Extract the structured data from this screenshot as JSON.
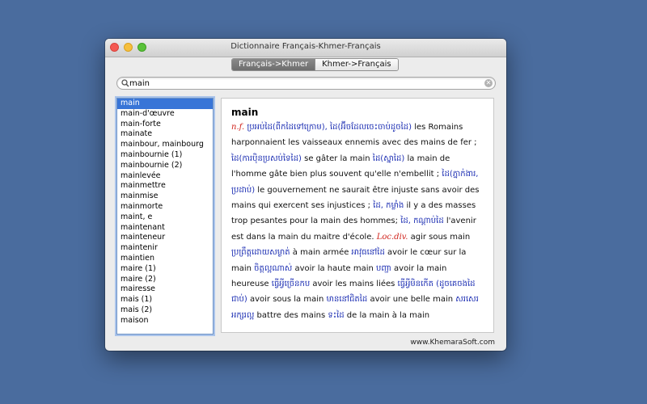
{
  "window": {
    "title": "Dictionnaire Français-Khmer-Français",
    "tabs": [
      {
        "label": "Français->Khmer",
        "active": true
      },
      {
        "label": "Khmer->Français",
        "active": false
      }
    ],
    "search": {
      "value": "main",
      "clear_icon": "clear-icon"
    },
    "footer": "www.KhemaraSoft.com"
  },
  "word_list": [
    "main",
    "main-d'œuvre",
    "main-forte",
    "mainate",
    "mainbour, mainbourg",
    "mainbournie (1)",
    "mainbournie (2)",
    "mainlevée",
    "mainmettre",
    "mainmise",
    "mainmorte",
    "maint, e",
    "maintenant",
    "mainteneur",
    "maintenir",
    "maintien",
    "maire (1)",
    "maire (2)",
    "mairesse",
    "mais (1)",
    "mais (2)",
    "maison"
  ],
  "entry": {
    "headword": "main",
    "segments": [
      {
        "t": "n.f.",
        "k": "abbr"
      },
      {
        "t": " ប្រអប់ដៃ(ពីកដៃទៅក្រោម), ដៃ(អ៊ីចដែលចេះចាប់ដូចដៃ)",
        "k": "km"
      },
      {
        "t": " les Romains harponnaient les vaisseaux ennemis avec des mains de fer ; ",
        "k": "fr"
      },
      {
        "t": "ដៃ(ការប៉ិនប្រសប់ទៃដៃ)",
        "k": "km"
      },
      {
        "t": " se gâter la main ",
        "k": "fr"
      },
      {
        "t": "ដៃ(ស្នាដៃ)",
        "k": "km"
      },
      {
        "t": " la main de l'homme gâte bien plus souvent qu'elle n'embellit ; ",
        "k": "fr"
      },
      {
        "t": "ដៃ(ភ្នាក់ងារ, ប្រដាប់)",
        "k": "km"
      },
      {
        "t": " le gouvernement ne saurait être injuste sans avoir des mains qui exercent ses injustices ; ",
        "k": "fr"
      },
      {
        "t": "ដៃ, កម្លាំង",
        "k": "km"
      },
      {
        "t": " il y a des masses trop pesantes pour la main des hommes; ",
        "k": "fr"
      },
      {
        "t": "ដៃ, កណ្ដាប់ដៃ",
        "k": "km"
      },
      {
        "t": " l'avenir est dans la main du maitre d'école. ",
        "k": "fr"
      },
      {
        "t": "Loc.div.",
        "k": "abbr"
      },
      {
        "t": " agir sous main ",
        "k": "fr"
      },
      {
        "t": "ប្រព្រឹត្តដោយសម្ងាត់",
        "k": "km"
      },
      {
        "t": " à main armée ",
        "k": "fr"
      },
      {
        "t": "អាវុធនៅដៃ",
        "k": "km"
      },
      {
        "t": " avoir le cœur sur la main ",
        "k": "fr"
      },
      {
        "t": "ចិត្តល្អណាស់",
        "k": "km"
      },
      {
        "t": " avoir la haute main ",
        "k": "fr"
      },
      {
        "t": "បញ្ជា",
        "k": "km"
      },
      {
        "t": " avoir la main heureuse ",
        "k": "fr"
      },
      {
        "t": "ធ្វើអ្វីច្រើនកប",
        "k": "km"
      },
      {
        "t": " avoir les mains liées ",
        "k": "fr"
      },
      {
        "t": "ធ្វើអ្វីមិនកើត (ដូចគេចងដៃជាប់)",
        "k": "km"
      },
      {
        "t": " avoir sous la main ",
        "k": "fr"
      },
      {
        "t": "មាននៅជិតដៃ",
        "k": "km"
      },
      {
        "t": " avoir une belle main ",
        "k": "fr"
      },
      {
        "t": "សរសេរអក្សរល្អ",
        "k": "km"
      },
      {
        "t": " battre des mains ",
        "k": "fr"
      },
      {
        "t": "ទះដៃ",
        "k": "km"
      },
      {
        "t": " de la main à la main",
        "k": "fr"
      }
    ]
  }
}
